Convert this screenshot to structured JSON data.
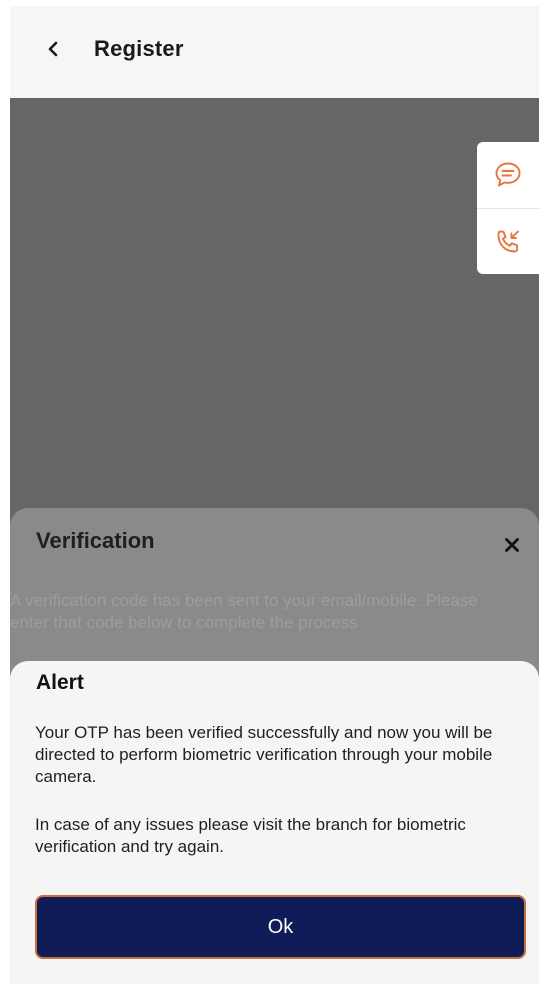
{
  "header": {
    "title": "Register",
    "back_icon": "back-chevron-icon"
  },
  "side_buttons": {
    "chat_icon": "chat-bubble-icon",
    "call_icon": "incoming-call-icon",
    "accent_color": "#e8743b"
  },
  "verification": {
    "title": "Verification",
    "message": "A verification code has been sent to your email/mobile. Please enter that code below to complete the process",
    "close_icon": "close-icon"
  },
  "alert": {
    "title": "Alert",
    "message_1": "Your OTP has been verified successfully and now you will be directed to perform biometric verification through your mobile camera.",
    "message_2": "In case of any issues please visit the branch for biometric verification and try again.",
    "ok_label": "Ok",
    "button_color": "#0f1c57",
    "button_border_color": "#c9703a"
  }
}
